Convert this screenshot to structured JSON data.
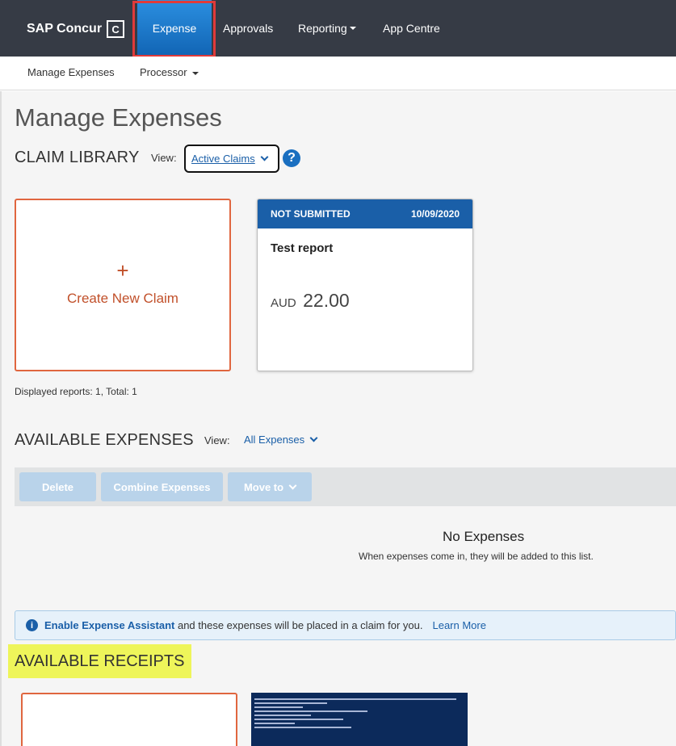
{
  "topnav": {
    "brand": "SAP Concur",
    "brand_mark": "C",
    "items": [
      "Expense",
      "Approvals",
      "Reporting",
      "App Centre"
    ]
  },
  "subnav": {
    "items": [
      "Manage Expenses",
      "Processor"
    ]
  },
  "page": {
    "title": "Manage Expenses"
  },
  "claim_library": {
    "title": "CLAIM LIBRARY",
    "view_label": "View:",
    "view_value": "Active Claims",
    "help": "?",
    "create_plus": "+",
    "create_label": "Create New Claim",
    "report": {
      "status": "NOT SUBMITTED",
      "date": "10/09/2020",
      "name": "Test report",
      "currency": "AUD",
      "amount": "22.00"
    },
    "displayed": "Displayed reports: 1, Total: 1"
  },
  "available_expenses": {
    "title": "AVAILABLE EXPENSES",
    "view_label": "View:",
    "view_value": "All Expenses",
    "buttons": [
      "Delete",
      "Combine Expenses",
      "Move to"
    ],
    "empty_title": "No Expenses",
    "empty_subtitle": "When expenses come in, they will be added to this list."
  },
  "assistant": {
    "icon": "i",
    "bold": "Enable Expense Assistant",
    "text": " and these expenses will be placed in a claim for you.",
    "link": "Learn More"
  },
  "available_receipts": {
    "title": "AVAILABLE RECEIPTS"
  },
  "colors": {
    "nav_bg": "#363b45",
    "accent_blue": "#1a5fa8",
    "create_orange": "#c1502a",
    "highlight_red": "#e03a3a",
    "highlight_yellow": "#eef55a"
  }
}
